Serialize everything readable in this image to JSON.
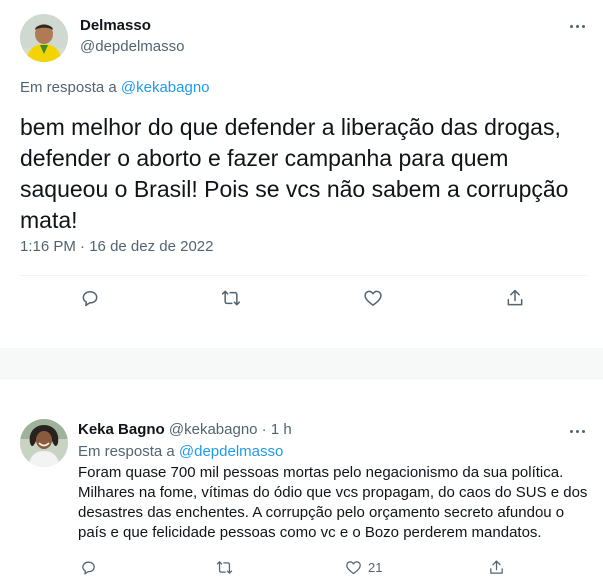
{
  "main_tweet": {
    "author_name": "Delmasso",
    "author_handle": "@depdelmasso",
    "reply_prefix": "Em resposta a",
    "reply_mention": "@kekabagno",
    "text": "bem melhor do que defender a liberação das drogas, defender o aborto e fazer campanha para quem saqueou o Brasil! Pois se vcs não sabem a corrupção mata!",
    "time": "1:16 PM",
    "separator": "·",
    "date": "16 de dez de 2022",
    "avatar_icon": "user-avatar"
  },
  "reply_tweet": {
    "author_name": "Keka Bagno",
    "author_handle": "@kekabagno",
    "separator": "·",
    "age": "1 h",
    "reply_prefix": "Em resposta a",
    "reply_mention": "@depdelmasso",
    "text": "Foram quase 700 mil pessoas mortas pelo negacionismo da sua política. Milhares na fome, vítimas do ódio que vcs propagam, do caos do SUS e dos desastres das enchentes. A corrupção pelo orçamento secreto afundou o país e que felicidade pessoas como vc e o Bozo perderem mandatos.",
    "like_count": "21"
  },
  "colors": {
    "accent": "#1d9bf0",
    "secondary_text": "#536471",
    "primary_text": "#0f1419"
  },
  "icons": [
    "reply-icon",
    "retweet-icon",
    "like-icon",
    "share-icon",
    "more-icon"
  ]
}
